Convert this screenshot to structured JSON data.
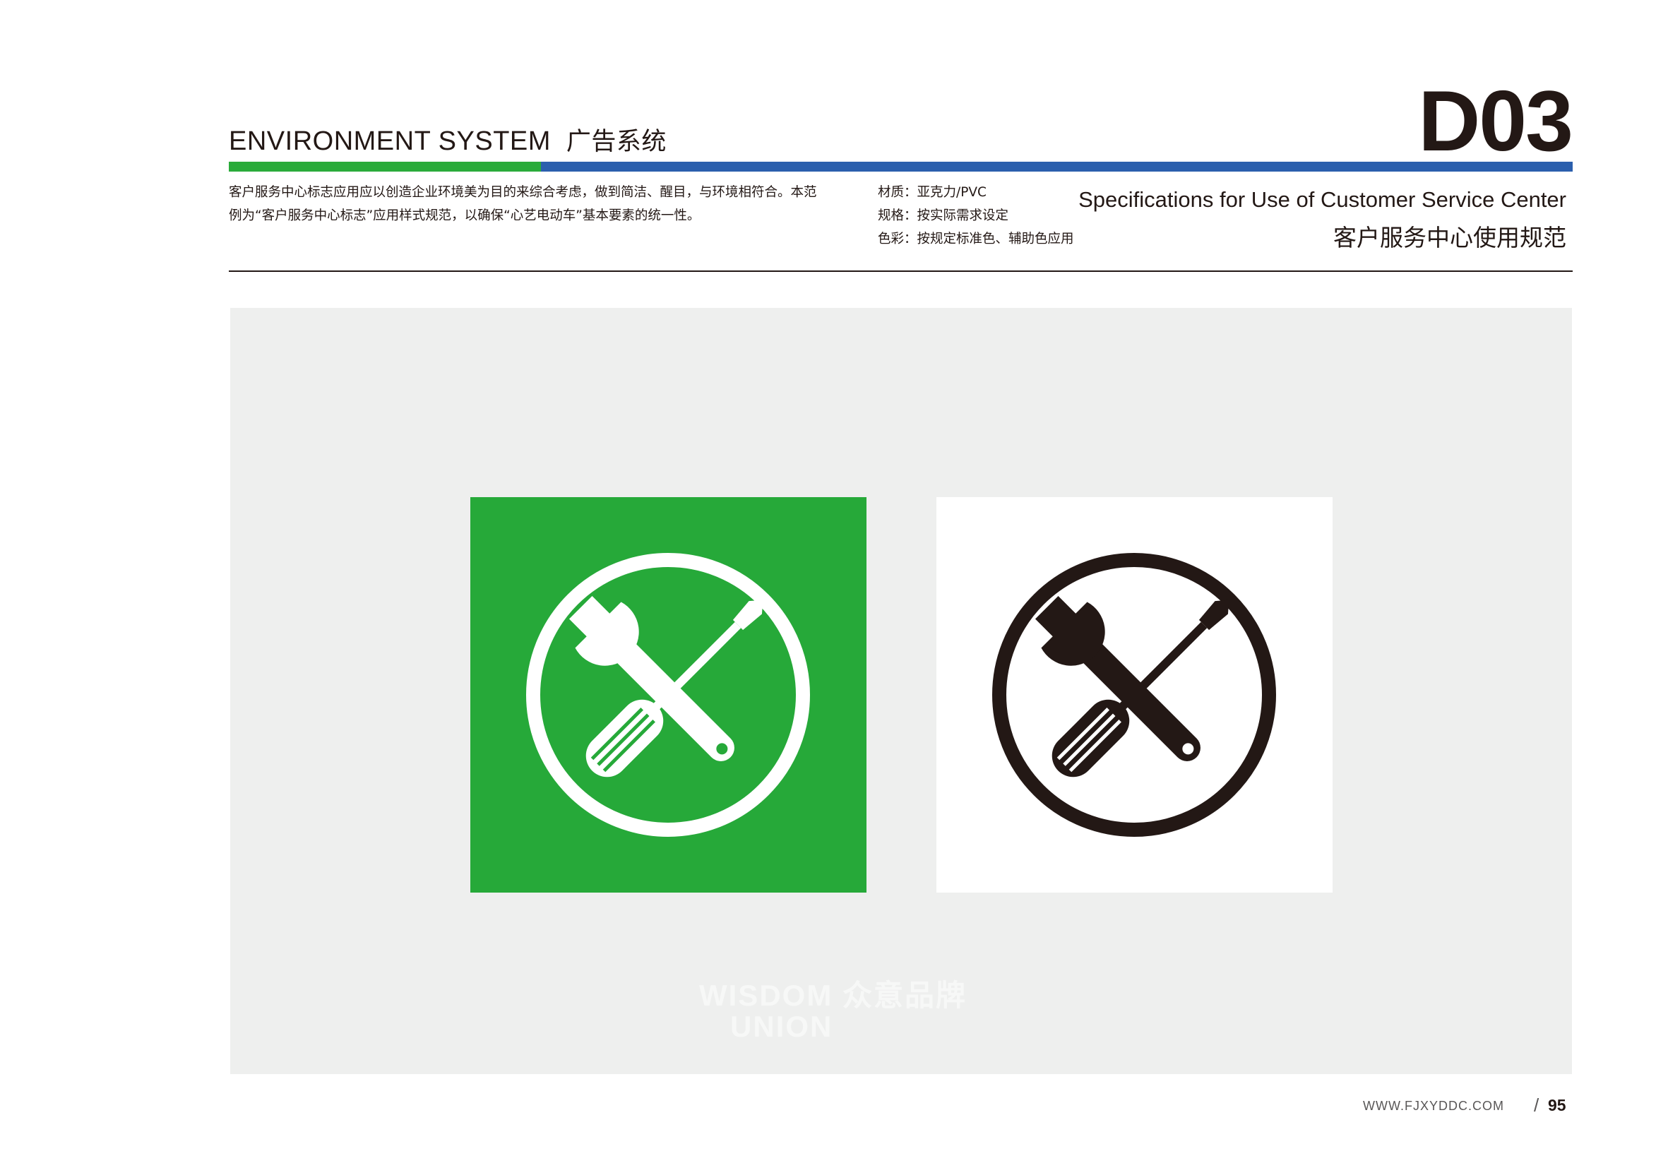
{
  "header": {
    "title_en": "ENVIRONMENT SYSTEM",
    "title_cn": "广告系统",
    "code": "D03"
  },
  "description": {
    "line1": "客户服务中心标志应用应以创造企业环境美为目的来综合考虑，做到简洁、醒目，与环境相符合。本范",
    "line2": "例为“客户服务中心标志”应用样式规范，以确保“心艺电动车”基本要素的统一性。"
  },
  "specs": {
    "material": "材质：亚克力/PVC",
    "size": "规格：按实际需求设定",
    "color": "色彩：按规定标准色、辅助色应用"
  },
  "section_title": {
    "en": "Specifications for Use of Customer Service Center",
    "cn": "客户服务中心使用规范"
  },
  "watermark": {
    "line1": "WISDOM 众意品牌",
    "line2": "UNION"
  },
  "footer": {
    "url": "WWW.FJXYDDC.COM",
    "slash": "/",
    "page_number": "95"
  },
  "colors": {
    "green": "#26a939",
    "blue": "#2b5fad",
    "black": "#231815",
    "panel": "#eeefee"
  },
  "icons": [
    "wrench-screwdriver-icon"
  ]
}
